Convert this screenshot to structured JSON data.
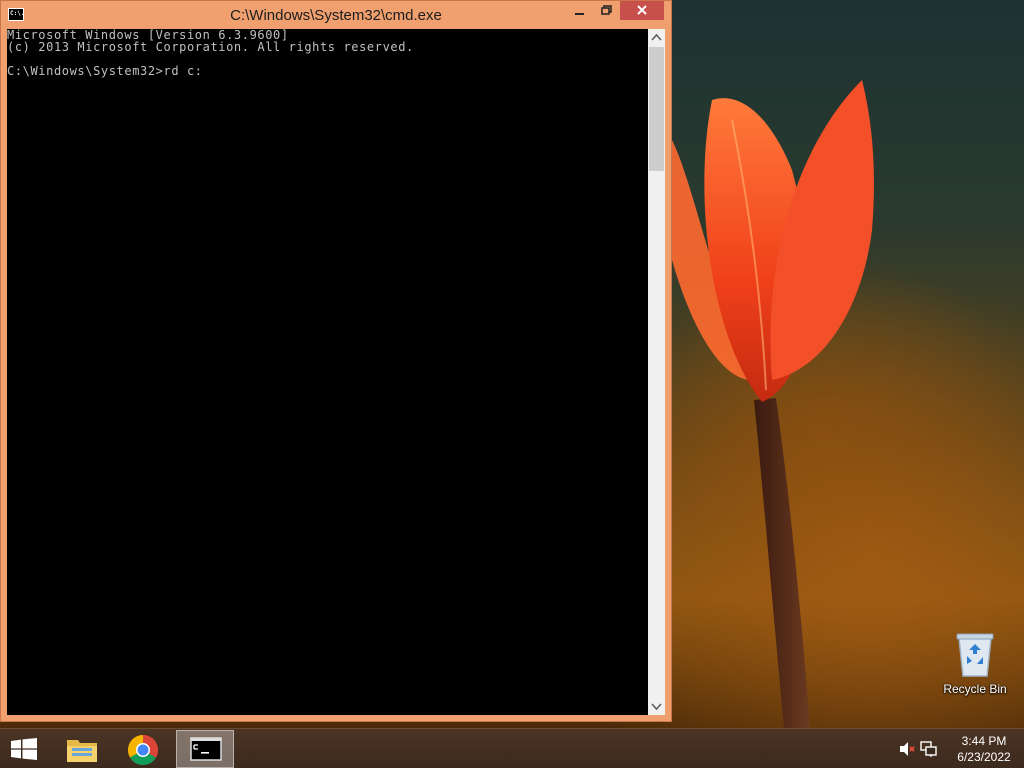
{
  "window": {
    "title": "C:\\Windows\\System32\\cmd.exe",
    "icon_label": "C:\\."
  },
  "console": {
    "lines": [
      "Microsoft Windows [Version 6.3.9600]",
      "(c) 2013 Microsoft Corporation. All rights reserved.",
      "",
      "C:\\Windows\\System32>rd c:"
    ]
  },
  "desktop": {
    "icons": [
      {
        "label": "Recycle Bin",
        "icon": "recycle-bin-icon"
      }
    ]
  },
  "taskbar": {
    "items": [
      {
        "name": "file-explorer",
        "icon": "folder-icon"
      },
      {
        "name": "google-chrome",
        "icon": "chrome-icon"
      },
      {
        "name": "command-prompt",
        "icon": "cmd-icon",
        "active": true
      }
    ],
    "clock": {
      "time": "3:44 PM",
      "date": "6/23/2022"
    }
  },
  "colors": {
    "titlebar": "#f0a06e",
    "close_button": "#c7504c",
    "console_bg": "#000000",
    "console_text": "#c0c0c0"
  }
}
